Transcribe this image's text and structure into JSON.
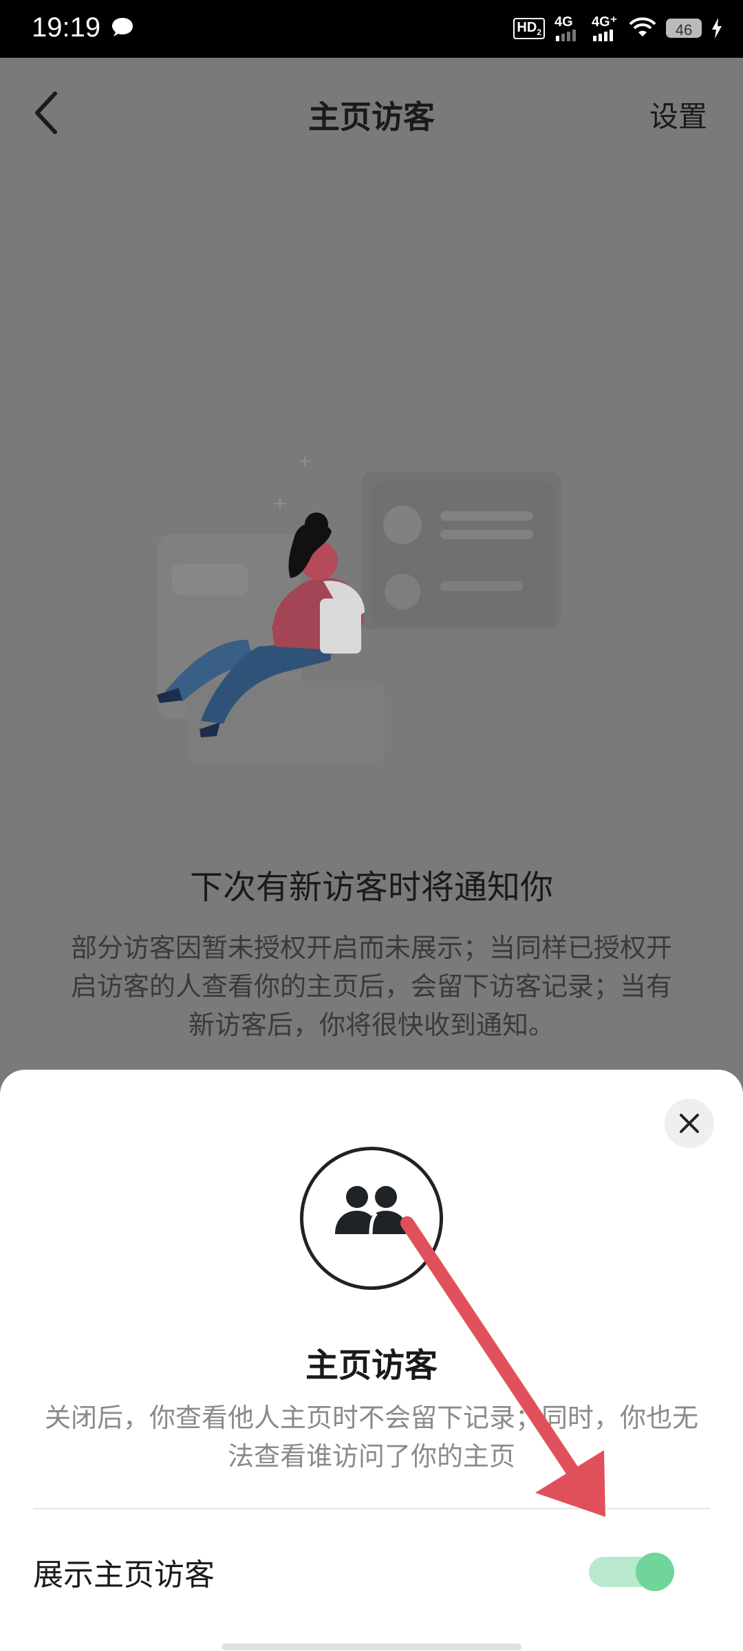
{
  "status_bar": {
    "time": "19:19",
    "network_1": "4G",
    "network_2": "4G⁺",
    "hd_label": "HD",
    "hd_sub": "2",
    "battery": "46"
  },
  "header": {
    "title": "主页访客",
    "settings": "设置"
  },
  "empty_state": {
    "title": "下次有新访客时将通知你",
    "description": "部分访客因暂未授权开启而未展示；当同样已授权开启访客的人查看你的主页后，会留下访客记录；当有新访客后，你将很快收到通知。"
  },
  "sheet": {
    "title": "主页访客",
    "description": "关闭后，你查看他人主页时不会留下记录；同时，你也无法查看谁访问了你的主页",
    "toggle_label": "展示主页访客",
    "toggle_on": true
  },
  "colors": {
    "toggle_on": "#6fd59a",
    "annotation_arrow": "#e0505a"
  }
}
